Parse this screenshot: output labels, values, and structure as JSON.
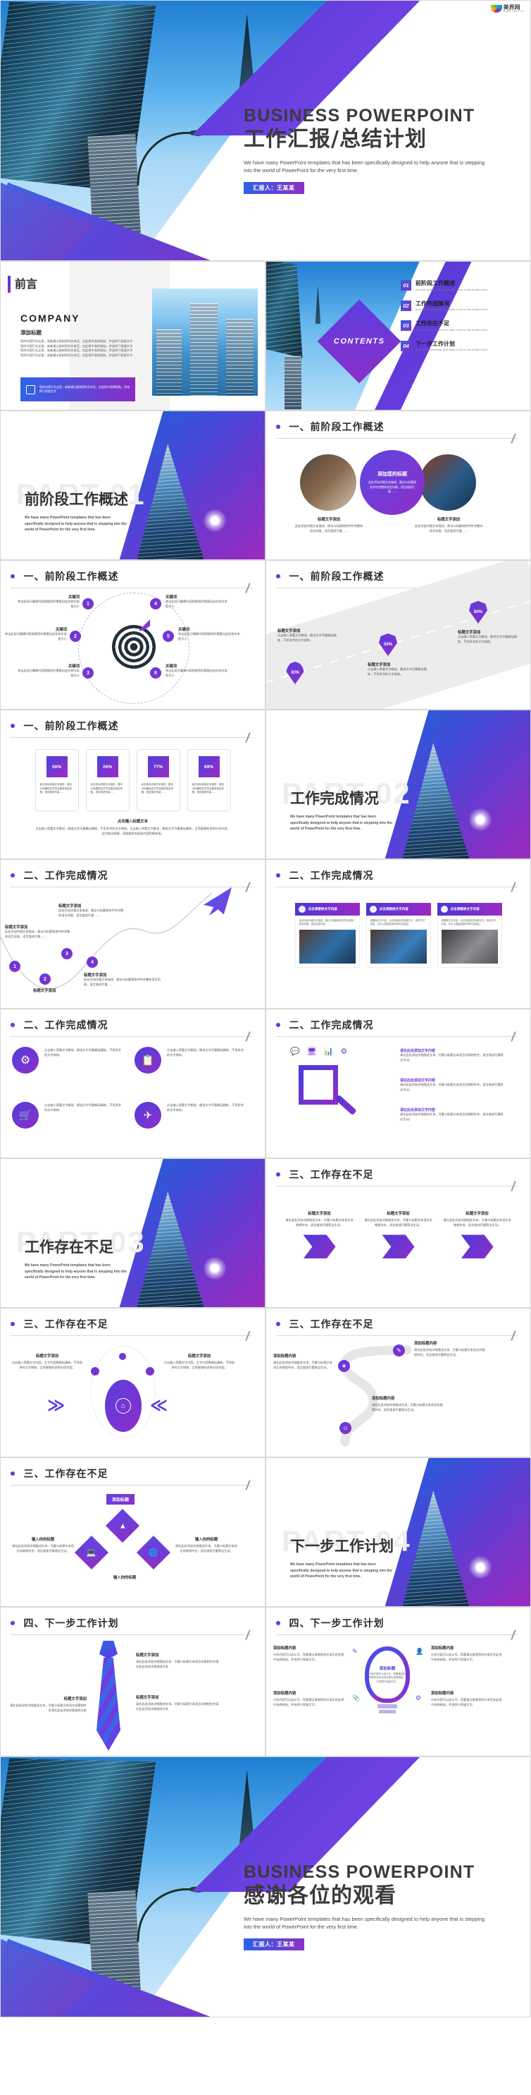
{
  "watermark": {
    "name": "美界网",
    "url": "WWW.YANJ.CN"
  },
  "cover": {
    "en_title": "BUSINESS POWERPOINT",
    "cn_title": "工作汇报/总结计划",
    "subtitle": "We have many PowerPoint templates that has been specifically designed to help anyone that is stepping into the world of PowerPoint for the very first time.",
    "badge": "汇报人：王某某"
  },
  "closing": {
    "en_title": "BUSINESS POWERPOINT",
    "cn_title": "感谢各位的观看",
    "subtitle": "We have many PowerPoint templates that has been specifically designed to help anyone that is stepping into the world of PowerPoint for the very first time.",
    "badge": "汇报人：王某某"
  },
  "preface": {
    "tab": "前言",
    "company": "COMPANY",
    "heading": "添加标题",
    "body": "您的内容打在这里，或者通过复制您的文本后，在此框中选择粘贴，并选择只保留文字您的内容打在这里，或者通过复制您的文本后，在此框中选择粘贴，并选择只保留文字您的内容打在这里，或者通过复制您的文本后，在此框中选择粘贴，并选择只保留文字您的内容打在这里，或者通过复制您的文本后，在此框中选择粘贴，并选择只保留文字",
    "cta": "您的内容打在这里，或者通过复制您的文本后，在此框中选择粘贴，并选择只保留文字"
  },
  "contents": {
    "label": "CONTENTS",
    "items": [
      {
        "num": "01",
        "title": "前阶段工作概述",
        "en": "print the presentation and make it into a film a wider field"
      },
      {
        "num": "02",
        "title": "工作完成情况",
        "en": "print the presentation and make it into a film a wider field"
      },
      {
        "num": "03",
        "title": "工作存在不足",
        "en": "print the presentation and make it into a film a wider field"
      },
      {
        "num": "04",
        "title": "下一步工作计划",
        "en": "print the presentation and make it into a film a wider field"
      }
    ]
  },
  "dividers": [
    {
      "ghost": "PART 01",
      "title": "前阶段工作概述",
      "sub": "We have many PowerPoint templates that has been specifically designed to help anyone that is stepping into the world of PowerPoint for the very first time."
    },
    {
      "ghost": "PART 02",
      "title": "工作完成情况",
      "sub": "We have many PowerPoint templates that has been specifically designed to help anyone that is stepping into the world of PowerPoint for the very first time."
    },
    {
      "ghost": "PART 03",
      "title": "工作存在不足",
      "sub": "We have many PowerPoint templates that has been specifically designed to help anyone that is stepping into the world of PowerPoint for the very first time."
    },
    {
      "ghost": "PART 04",
      "title": "下一步工作计划",
      "sub": "We have many PowerPoint templates that has been specifically designed to help anyone that is stepping into the world of PowerPoint for the very first time."
    }
  ],
  "section_titles": {
    "s1": "一、前阶段工作概述",
    "s2": "二、工作完成情况",
    "s3": "三、工作存在不足",
    "s4": "四、下一步工作计划"
  },
  "slide_circles": {
    "center_title": "添加您的标题",
    "center_body": "此处添加详细文本描述，建议与标题相关并符合整体语言风格，语言描述尽量……",
    "left_title": "标题文字添加",
    "left_body": "此处添加详细文本描述，建议与标题相关并符合整体语言风格，语言描述尽量……",
    "right_title": "标题文字添加",
    "right_body": "此处添加详细文本描述，建议与标题相关并符合整体语言风格，语言描述尽量……"
  },
  "slide_target": {
    "keywords": [
      {
        "n": "1",
        "title": "关键词",
        "body": "单击此处可编辑内容根据您的需要自由拉伸文本框大小"
      },
      {
        "n": "2",
        "title": "关键词",
        "body": "单击此处可编辑内容根据您的需要自由拉伸文本框大小"
      },
      {
        "n": "3",
        "title": "关键词",
        "body": "单击此处可编辑内容根据您的需要自由拉伸文本框大小"
      },
      {
        "n": "4",
        "title": "关键词",
        "body": "单击此处可编辑内容根据您的需要自由拉伸文本框大小"
      },
      {
        "n": "5",
        "title": "关键词",
        "body": "单击此处可编辑内容根据您的需要自由拉伸文本框大小"
      },
      {
        "n": "6",
        "title": "关键词",
        "body": "单击此处可编辑内容根据您的需要自由拉伸文本框大小"
      }
    ]
  },
  "slide_road": {
    "steps": [
      {
        "pct": "30%",
        "title": "标题文字添加",
        "body": "点击输入简要文字解说，解说文字尽量概括精炼，不用多余的文字修饰。"
      },
      {
        "pct": "50%",
        "title": "标题文字添加",
        "body": "点击输入简要文字解说，解说文字尽量概括精炼，不用多余的文字修饰。"
      },
      {
        "pct": "80%",
        "title": "标题文字添加",
        "body": "点击输入简要文字解说，解说文字尽量概括精炼，不用多余的文字修饰。"
      }
    ]
  },
  "slide_percent": {
    "cards": [
      {
        "pct": "56%",
        "body": "此处添加详细文本描述，建议与标题相关并符合整体语言风格，语言描述尽量……"
      },
      {
        "pct": "26%",
        "body": "此处添加详细文本描述，建议与标题相关并符合整体语言风格，语言描述尽量……"
      },
      {
        "pct": "77%",
        "body": "此处添加详细文本描述，建议与标题相关并符合整体语言风格，语言描述尽量……"
      },
      {
        "pct": "69%",
        "body": "此处添加详细文本描述，建议与标题相关并符合整体语言风格，语言描述尽量……"
      }
    ],
    "footer_title": "点击输入标题文本",
    "footer_body": "点击输入简要文字解说，解说文字尽量概括精炼，不用多余的文字修饰。点击输入简要文字解说，解说文字尽量概括精炼，言简意赅的说明分项内容，此为概念图解，请根据您的具体内容酌情修改。"
  },
  "slide_curve": {
    "nodes": [
      {
        "n": "1",
        "title": "标题文字添加",
        "body": "此处添加详细文本描述，建议与标题相关并符合整体语言风格，语言描述尽量……"
      },
      {
        "n": "2",
        "title": "标题文字添加",
        "body": "此处添加详细文本描述，建议与标题相关并符合整体语言风格，语言描述尽量……"
      },
      {
        "n": "3",
        "title": "标题文字添加",
        "body": "此处添加详细文本描述，建议与标题相关并符合整体语言风格，语言描述尽量……"
      },
      {
        "n": "4",
        "title": "标题文字添加",
        "body": "此处添加详细文本描述，建议与标题相关并符合整体语言风格，语言描述尽量……"
      }
    ]
  },
  "slide_photocards": {
    "cards": [
      {
        "header": "点击请替换文字内容",
        "body": "此处添加详细文本描述，建议与标题相关并符合整体语言风格，语言描述尽量……"
      },
      {
        "header": "点击请替换文字内容",
        "body": "请替换文字内容，点击添加相关标题文字，修改文字内容，也可以直接复制你的内容到此。"
      },
      {
        "header": "点击请替换文字内容",
        "body": "请替换文字内容，点击添加相关标题文字，修改文字内容，也可以直接复制你的内容到此。"
      }
    ]
  },
  "slide_icons4": {
    "items": [
      {
        "title": "标题文字添加",
        "body": "点击输入简要文字解说，解说文字尽量概括精炼，不用多余的文字修饰。"
      },
      {
        "title": "标题文字添加",
        "body": "点击输入简要文字解说，解说文字尽量概括精炼，不用多余的文字修饰。"
      },
      {
        "title": "标题文字添加",
        "body": "点击输入简要文字解说，解说文字尽量概括精炼，不用多余的文字修饰。"
      },
      {
        "title": "标题文字添加",
        "body": "点击输入简要文字解说，解说文字尽量概括精炼，不用多余的文字修饰。"
      }
    ]
  },
  "slide_magnifier": {
    "items": [
      {
        "title": "请在此处添加文字内容",
        "body": "请在此处添加详细描述文本，尽量与标题文本语言风格相符合，语言描述尽量简洁生动。"
      },
      {
        "title": "请在此处添加文字内容",
        "body": "请在此处添加详细描述文本，尽量与标题文本语言风格相符合，语言描述尽量简洁生动。"
      },
      {
        "title": "请在此处添加文字内容",
        "body": "请在此处添加详细描述文本，尽量与标题文本语言风格相符合，语言描述尽量简洁生动。"
      }
    ]
  },
  "slide_chevrons": {
    "items": [
      {
        "title": "标题文字添加",
        "body": "请在此处添加详细描述文本，尽量与标题文本语言风格相符合，语言描述尽量简洁生动。"
      },
      {
        "title": "标题文字添加",
        "body": "请在此处添加详细描述文本，尽量与标题文本语言风格相符合，语言描述尽量简洁生动。"
      },
      {
        "title": "标题文字添加",
        "body": "请在此处添加详细描述文本，尽量与标题文本语言风格相符合，语言描述尽量简洁生动。"
      }
    ]
  },
  "slide_orbit": {
    "left_title": "标题文字添加",
    "left_body": "点击输入简要文字内容，文字内容需概括精炼，不用多余的文字修饰，言简意赅的说明分项内容。",
    "right_title": "标题文字添加",
    "right_body": "点击输入简要文字内容，文字内容需概括精炼，不用多余的文字修饰，言简意赅的说明分项内容。"
  },
  "slide_path": {
    "items": [
      {
        "title": "添加标题内容",
        "body": "请在此处添加详细描述文本，尽量与标题文本语言风格相符合，语言描述尽量简洁生动。"
      },
      {
        "title": "添加标题内容",
        "body": "请在此处添加详细描述文本，尽量与标题文本语言风格相符合，语言描述尽量简洁生动。"
      },
      {
        "title": "添加标题内容",
        "body": "请在此处添加详细描述文本，尽量与标题文本语言风格相符合，语言描述尽量简洁生动。"
      }
    ]
  },
  "slide_rhombus": {
    "center": "添加标题",
    "left_title": "输入你的标题",
    "left_body": "请在此处添加详细描述文本，尽量与标题文本语言风格相符合，语言描述尽量简洁生动。",
    "right_title": "输入你的标题",
    "right_body": "请在此处添加详细描述文本，尽量与标题文本语言风格相符合，语言描述尽量简洁生动。",
    "side_title": "输入你的标题",
    "side_body": "请在此处添加详细描述文本，尽量与标题文本语言风格相符合，语言描述尽量简洁生动。"
  },
  "slide_tie": {
    "items": [
      {
        "title": "标题文字添加",
        "body": "请在此处添加详细描述文本，尽量与标题文本语言风格相符合请在此处添加详细描述文本"
      },
      {
        "title": "标题文字添加",
        "body": "请在此处添加详细描述文本，尽量与标题文本语言风格相符合请在此处添加详细描述文本"
      },
      {
        "title": "标题文字添加",
        "body": "请在此处添加详细描述文本，尽量与标题文本语言风格相符合请在此处添加详细描述文本"
      }
    ]
  },
  "slide_bulb": {
    "center": "添加标题",
    "center_body": "分析内容可以这么写，您要通过复制您的文本后在此框中选择粘贴，并选择只保留文字。",
    "items": [
      {
        "title": "添加标题内容",
        "body": "分析内容可以这么写，您要通过复制您的文本后在此框中选择粘贴，并选择只保留文字。"
      },
      {
        "title": "添加标题内容",
        "body": "分析内容可以这么写，您要通过复制您的文本后在此框中选择粘贴，并选择只保留文字。"
      },
      {
        "title": "添加标题内容",
        "body": "分析内容可以这么写，您要通过复制您的文本后在此框中选择粘贴，并选择只保留文字。"
      },
      {
        "title": "添加标题内容",
        "body": "分析内容可以这么写，您要通过复制您的文本后在此框中选择粘贴，并选择只保留文字。"
      }
    ]
  }
}
